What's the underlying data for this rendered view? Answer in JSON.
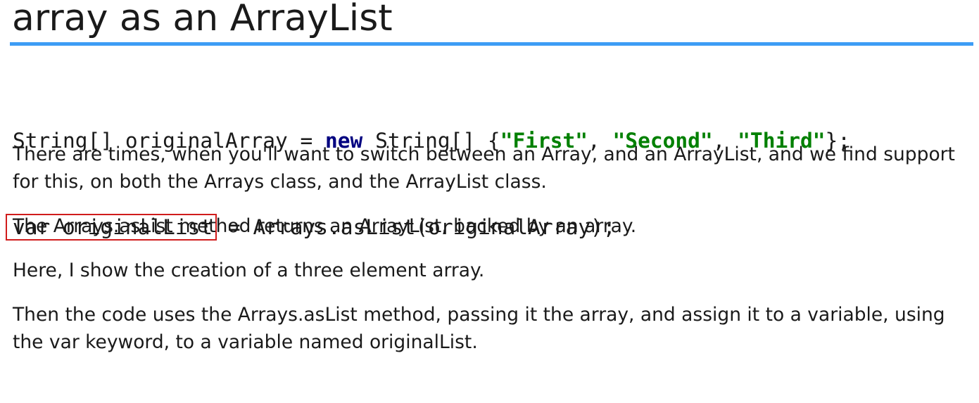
{
  "slide": {
    "title": "array as an ArrayList",
    "code": {
      "line1": {
        "t1": "String[] originalArray = ",
        "kw": "new",
        "t2": " String[] {",
        "s1": "\"First\"",
        "sep1": ", ",
        "s2": "\"Second\"",
        "sep2": ", ",
        "s3": "\"Third\"",
        "t3": "};"
      },
      "line2": {
        "highlighted": "var originalList",
        "rest": " = Arrays.asList(originalArray);"
      }
    },
    "paragraphs": [
      "There are times, when you'll want to switch between an Array, and an ArrayList, and we find support for this, on both the Arrays class, and the ArrayList class.",
      "The Arrays.asList method returns an ArrayList, backed by an array.",
      "Here, I show the creation of a three element array.",
      "Then the code uses the Arrays.asList method, passing it the array, and assign it to a variable, using the var keyword, to a variable named originalList."
    ],
    "colors": {
      "rule": "#3d9df5",
      "keyword": "#000080",
      "string": "#008000",
      "highlight_box": "#d01c1c"
    }
  }
}
